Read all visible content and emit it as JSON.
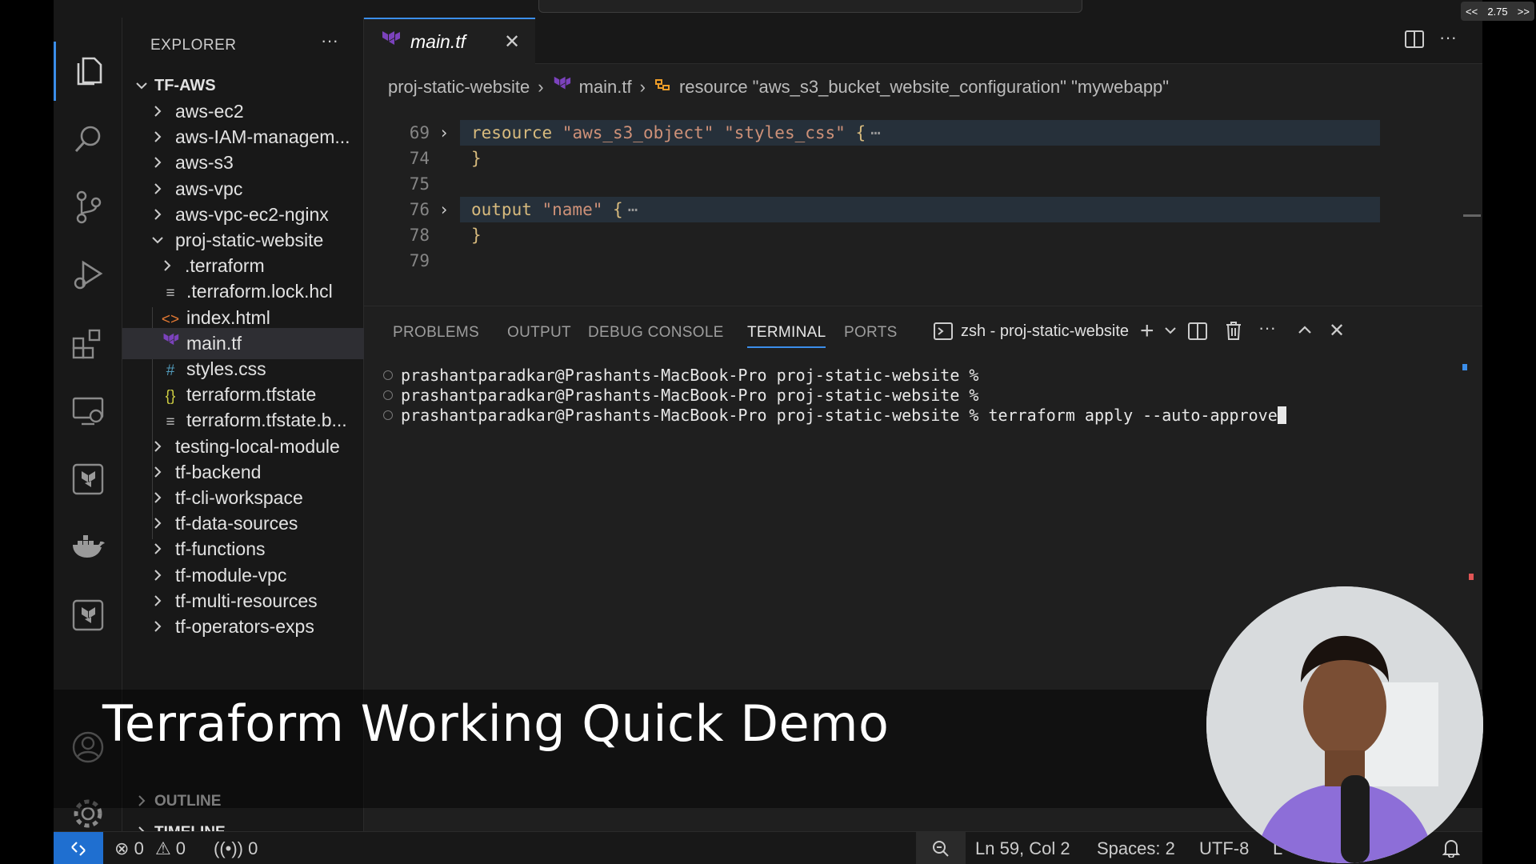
{
  "explorer": {
    "title": "EXPLORER",
    "more": "···",
    "root": "TF-AWS",
    "items": [
      {
        "label": "aws-ec2"
      },
      {
        "label": "aws-IAM-managem..."
      },
      {
        "label": "aws-s3"
      },
      {
        "label": "aws-vpc"
      },
      {
        "label": "aws-vpc-ec2-nginx"
      },
      {
        "label": "proj-static-website"
      },
      {
        "label": ".terraform"
      },
      {
        "label": ".terraform.lock.hcl"
      },
      {
        "label": "index.html"
      },
      {
        "label": "main.tf"
      },
      {
        "label": "styles.css"
      },
      {
        "label": "terraform.tfstate"
      },
      {
        "label": "terraform.tfstate.b..."
      },
      {
        "label": "testing-local-module"
      },
      {
        "label": "tf-backend"
      },
      {
        "label": "tf-cli-workspace"
      },
      {
        "label": "tf-data-sources"
      },
      {
        "label": "tf-functions"
      },
      {
        "label": "tf-module-vpc"
      },
      {
        "label": "tf-multi-resources"
      },
      {
        "label": "tf-operators-exps"
      }
    ],
    "outline": "OUTLINE",
    "timeline": "TIMELINE"
  },
  "editor": {
    "tab_label": "main.tf",
    "breadcrumb": {
      "folder": "proj-static-website",
      "file": "main.tf",
      "symbol": "resource \"aws_s3_bucket_website_configuration\" \"mywebapp\""
    },
    "lines": [
      {
        "num": "69",
        "kw": "resource",
        "rest": " \"aws_s3_object\" \"styles_css\" ",
        "brace": "{",
        "fold": "›",
        "ell": "⋯"
      },
      {
        "num": "74",
        "kw": "",
        "rest": "",
        "brace": "}",
        "fold": "",
        "ell": ""
      },
      {
        "num": "75",
        "kw": "",
        "rest": "",
        "brace": "",
        "fold": "",
        "ell": ""
      },
      {
        "num": "76",
        "kw": "output",
        "rest": " \"name\" ",
        "brace": "{",
        "fold": "›",
        "ell": "⋯"
      },
      {
        "num": "78",
        "kw": "",
        "rest": "",
        "brace": "}",
        "fold": "",
        "ell": ""
      },
      {
        "num": "79",
        "kw": "",
        "rest": "",
        "brace": "",
        "fold": "",
        "ell": ""
      }
    ]
  },
  "panel": {
    "tabs": [
      "PROBLEMS",
      "OUTPUT",
      "DEBUG CONSOLE",
      "TERMINAL",
      "PORTS"
    ],
    "active_tab": "TERMINAL",
    "terminal_name": "zsh - proj-static-website",
    "lines": [
      "prashantparadkar@Prashants-MacBook-Pro proj-static-website %",
      "prashantparadkar@Prashants-MacBook-Pro proj-static-website %",
      "prashantparadkar@Prashants-MacBook-Pro proj-static-website % terraform apply --auto-approve"
    ]
  },
  "status": {
    "errors": "0",
    "warnings": "0",
    "ports": "0",
    "position": "Ln 59, Col 2",
    "spaces": "Spaces: 2",
    "encoding": "UTF-8",
    "eol": "L"
  },
  "video": {
    "caption": "Terraform Working Quick Demo",
    "speed": "2.75",
    "speed_down": "<<",
    "speed_up": ">>"
  },
  "colors": {
    "accent": "#3b8eea",
    "terraform_purple": "#7b42bc",
    "keyword": "#d7ba7d",
    "string": "#ce9178"
  }
}
